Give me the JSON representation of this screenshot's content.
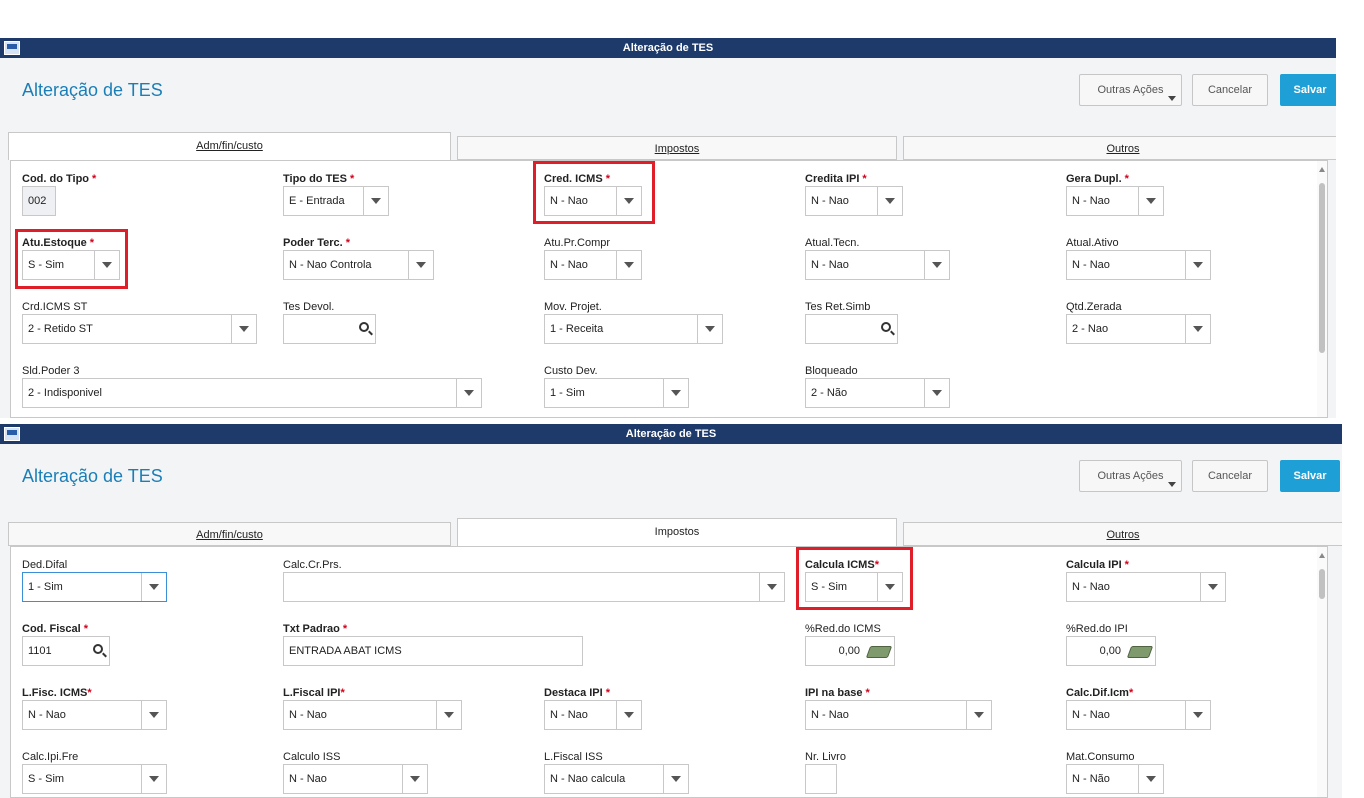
{
  "window_title": "Alteração de TES",
  "page_title": "Alteração de TES",
  "buttons": {
    "more": "Outras Ações",
    "cancel": "Cancelar",
    "save": "Salvar"
  },
  "tabs": [
    {
      "label": "Adm/fin/custo"
    },
    {
      "label": "Impostos"
    },
    {
      "label": "Outros"
    }
  ],
  "panel1": {
    "cod_tipo": {
      "label": "Cod. do Tipo",
      "value": "002"
    },
    "tipo_tes": {
      "label": "Tipo do TES",
      "value": "E - Entrada"
    },
    "cred_icms": {
      "label": "Cred. ICMS",
      "value": "N - Nao"
    },
    "credita_ipi": {
      "label": "Credita IPI",
      "value": "N - Nao"
    },
    "gera_dupl": {
      "label": "Gera Dupl.",
      "value": "N - Nao"
    },
    "atu_estoque": {
      "label": "Atu.Estoque",
      "value": "S - Sim"
    },
    "poder_terc": {
      "label": "Poder Terc.",
      "value": "N - Nao Controla"
    },
    "atu_pr_compr": {
      "label": "Atu.Pr.Compr",
      "value": "N - Nao"
    },
    "atual_tecn": {
      "label": "Atual.Tecn.",
      "value": "N - Nao"
    },
    "atual_ativo": {
      "label": "Atual.Ativo",
      "value": "N - Nao"
    },
    "crd_icms_st": {
      "label": "Crd.ICMS ST",
      "value": "2 - Retido ST"
    },
    "tes_devol": {
      "label": "Tes Devol.",
      "value": ""
    },
    "mov_projet": {
      "label": "Mov. Projet.",
      "value": "1 - Receita"
    },
    "tes_ret_simb": {
      "label": "Tes Ret.Simb",
      "value": ""
    },
    "qtd_zerada": {
      "label": "Qtd.Zerada",
      "value": "2 - Nao"
    },
    "sld_poder3": {
      "label": "Sld.Poder 3",
      "value": "2 - Indisponivel"
    },
    "custo_dev": {
      "label": "Custo Dev.",
      "value": "1 - Sim"
    },
    "bloqueado": {
      "label": "Bloqueado",
      "value": "2 - Não"
    }
  },
  "panel2": {
    "ded_difal": {
      "label": "Ded.Difal",
      "value": "1 - Sim"
    },
    "calc_cr_prs": {
      "label": "Calc.Cr.Prs.",
      "value": ""
    },
    "calcula_icms": {
      "label": "Calcula ICMS",
      "value": "S - Sim"
    },
    "calcula_ipi": {
      "label": "Calcula IPI",
      "value": "N - Nao"
    },
    "cod_fiscal": {
      "label": "Cod. Fiscal",
      "value": "1101"
    },
    "txt_padrao": {
      "label": "Txt Padrao",
      "value": "ENTRADA ABAT ICMS"
    },
    "red_icms": {
      "label": "%Red.do ICMS",
      "value": "0,00"
    },
    "red_ipi": {
      "label": "%Red.do IPI",
      "value": "0,00"
    },
    "lfisc_icms": {
      "label": "L.Fisc. ICMS",
      "value": "N - Nao"
    },
    "lfiscal_ipi": {
      "label": "L.Fiscal IPI",
      "value": "N - Nao"
    },
    "destaca_ipi": {
      "label": "Destaca IPI",
      "value": "N - Nao"
    },
    "ipi_base": {
      "label": "IPI na base",
      "value": "N - Nao"
    },
    "calc_dif_icm": {
      "label": "Calc.Dif.Icm",
      "value": "N - Nao"
    },
    "calc_ipi_fre": {
      "label": "Calc.Ipi.Fre",
      "value": "S - Sim"
    },
    "calculo_iss": {
      "label": "Calculo ISS",
      "value": "N - Nao"
    },
    "lfiscal_iss": {
      "label": "L.Fiscal ISS",
      "value": "N - Nao calcula"
    },
    "nr_livro": {
      "label": "Nr. Livro",
      "value": ""
    },
    "mat_consumo": {
      "label": "Mat.Consumo",
      "value": "N - Não"
    }
  },
  "colors": {
    "titlebar": "#1e3a6b",
    "accent": "#1a7fb8",
    "save": "#1e9fd6",
    "required": "#d0021b",
    "highlight": "#e01e2a"
  }
}
